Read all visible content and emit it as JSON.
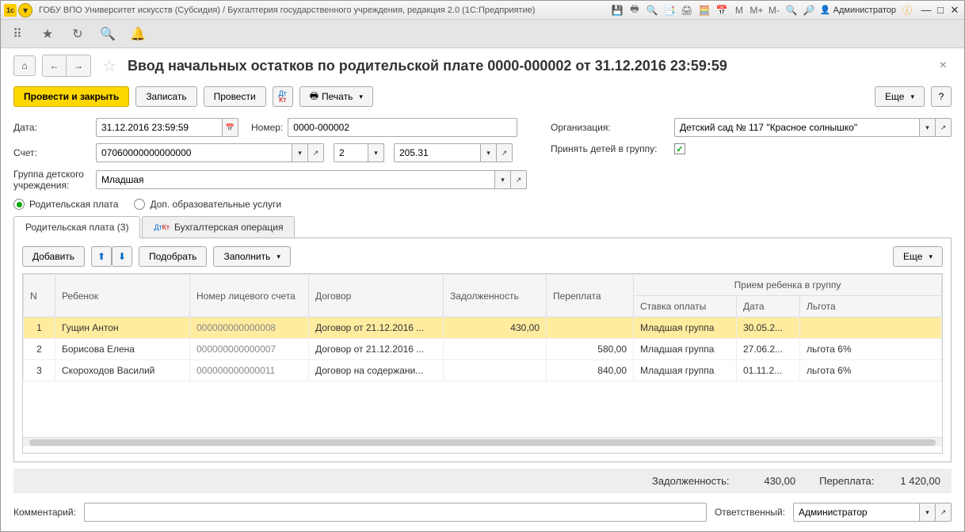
{
  "titlebar": {
    "title": "ГОБУ ВПО Университет искусств (Субсидия) / Бухгалтерия государственного учреждения, редакция 2.0  (1С:Предприятие)",
    "user": "Администратор"
  },
  "page": {
    "title": "Ввод начальных остатков по родительской плате 0000-000002 от 31.12.2016 23:59:59"
  },
  "actions": {
    "post_close": "Провести и закрыть",
    "write": "Записать",
    "post": "Провести",
    "print": "Печать",
    "more": "Еще"
  },
  "form": {
    "date_lbl": "Дата:",
    "date_val": "31.12.2016 23:59:59",
    "number_lbl": "Номер:",
    "number_val": "0000-000002",
    "account_lbl": "Счет:",
    "account_val": "07060000000000000",
    "account_p2": "2",
    "account_p3": "205.31",
    "group_lbl": "Группа детского учреждения:",
    "group_val": "Младшая",
    "org_lbl": "Организация:",
    "org_val": "Детский сад № 117 \"Красное солнышко\"",
    "accept_lbl": "Принять детей в группу:"
  },
  "radios": {
    "r1": "Родительская плата",
    "r2": "Доп. образовательные услуги"
  },
  "tabs": {
    "t1": "Родительская плата (3)",
    "t2": "Бухгалтерская операция"
  },
  "table_actions": {
    "add": "Добавить",
    "pick": "Подобрать",
    "fill": "Заполнить",
    "more": "Еще"
  },
  "table": {
    "headers": {
      "n": "N",
      "child": "Ребенок",
      "account": "Номер лицевого счета",
      "contract": "Договор",
      "debt": "Задолженность",
      "overpay": "Переплата",
      "admission": "Прием ребенка в группу",
      "rate": "Ставка оплаты",
      "date": "Дата",
      "benefit": "Льгота"
    },
    "rows": [
      {
        "n": "1",
        "child": "Гущин Антон",
        "account": "000000000000008",
        "contract": "Договор от 21.12.2016 ...",
        "debt": "430,00",
        "overpay": "",
        "rate": "Младшая группа",
        "date": "30.05.2...",
        "benefit": ""
      },
      {
        "n": "2",
        "child": "Борисова Елена",
        "account": "000000000000007",
        "contract": "Договор от 21.12.2016 ...",
        "debt": "",
        "overpay": "580,00",
        "rate": "Младшая группа",
        "date": "27.06.2...",
        "benefit": "льгота 6%"
      },
      {
        "n": "3",
        "child": "Скороходов Василий",
        "account": "000000000000011",
        "contract": "Договор на содержани...",
        "debt": "",
        "overpay": "840,00",
        "rate": "Младшая группа",
        "date": "01.11.2...",
        "benefit": "льгота 6%"
      }
    ]
  },
  "totals": {
    "debt_lbl": "Задолженность:",
    "debt_val": "430,00",
    "overpay_lbl": "Переплата:",
    "overpay_val": "1 420,00"
  },
  "footer": {
    "comment_lbl": "Комментарий:",
    "resp_lbl": "Ответственный:",
    "resp_val": "Администратор"
  }
}
